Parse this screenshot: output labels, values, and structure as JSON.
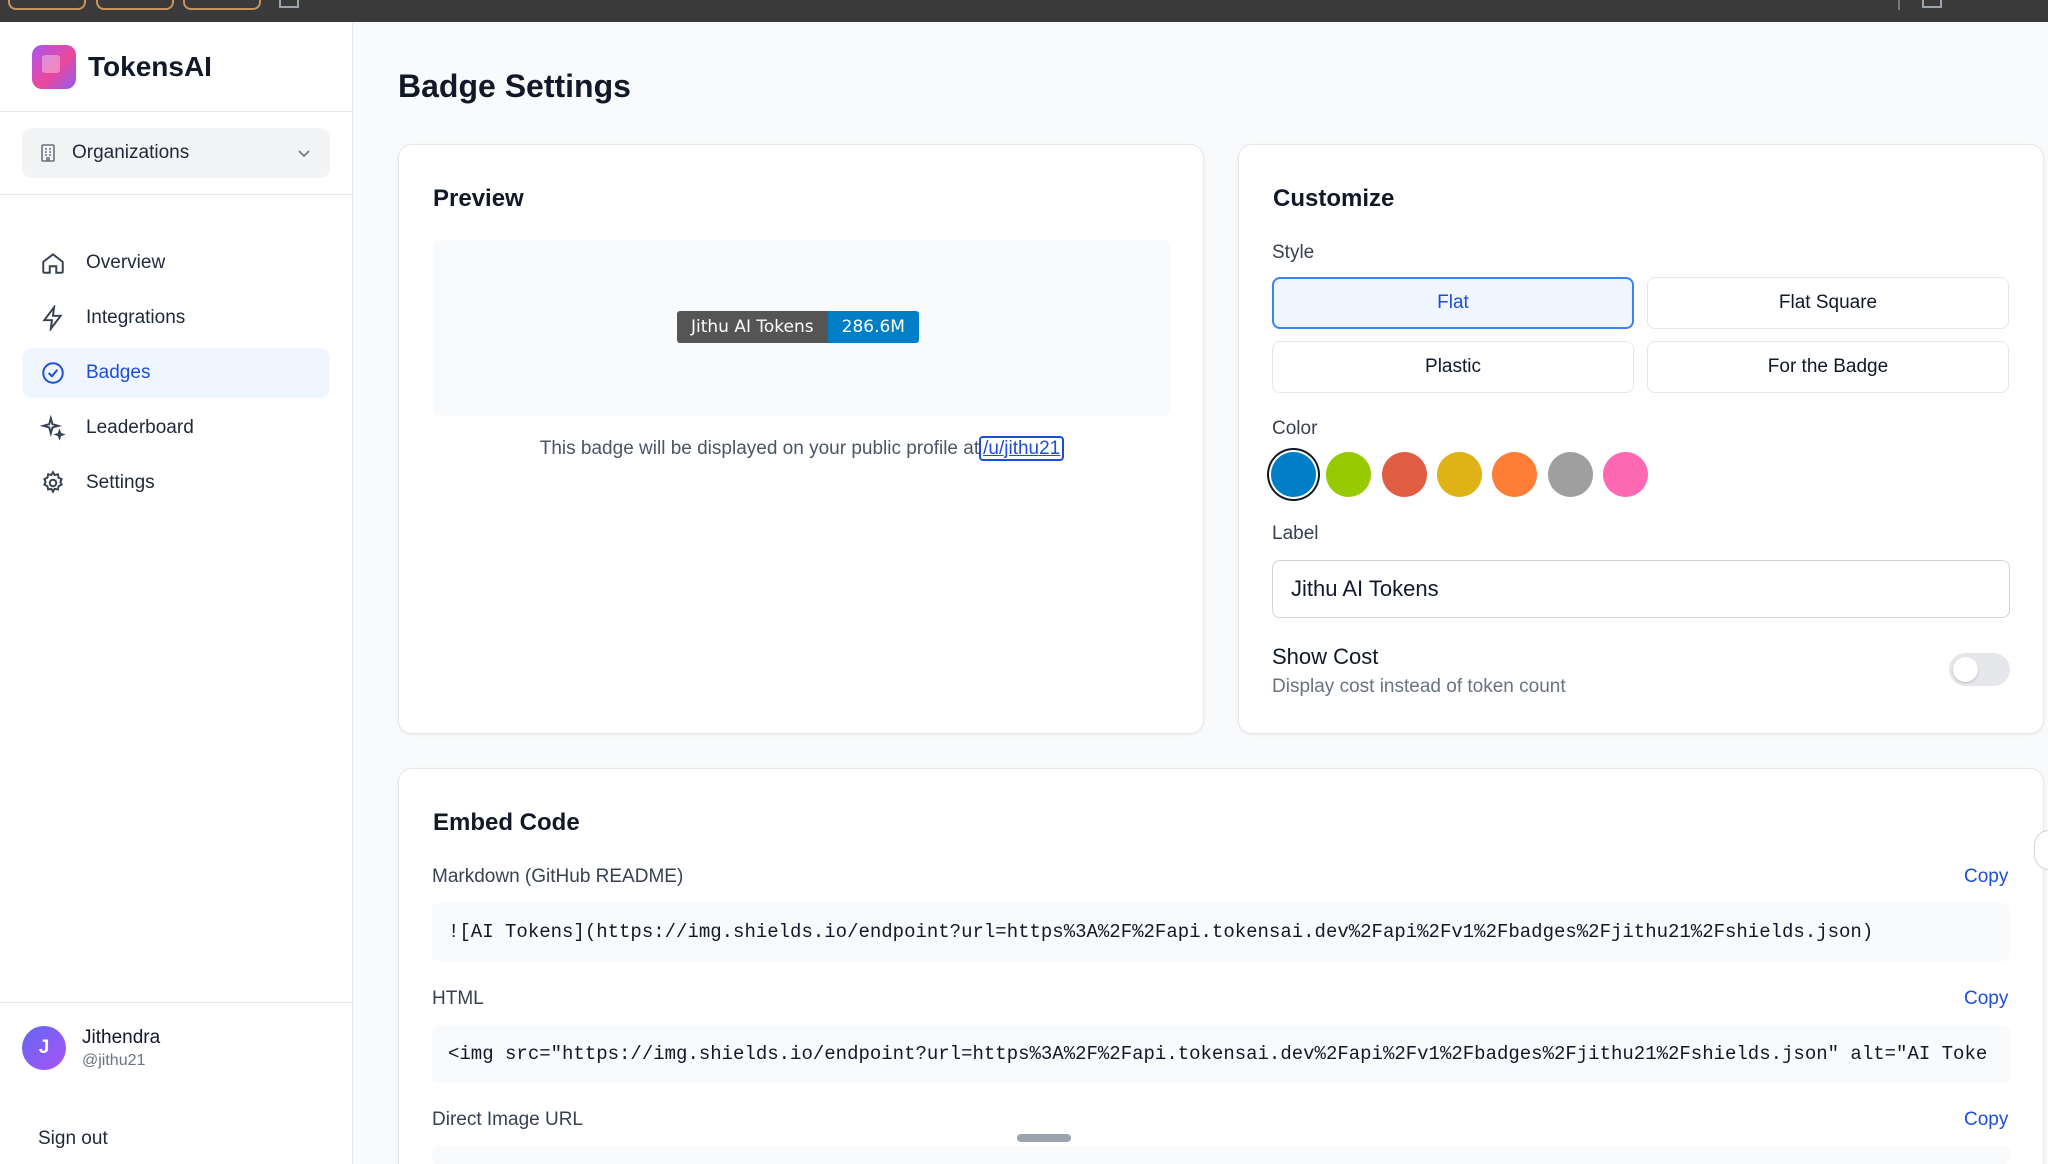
{
  "app": {
    "name": "TokensAI"
  },
  "org_selector": {
    "label": "Organizations"
  },
  "nav": [
    {
      "label": "Overview",
      "icon": "home-icon"
    },
    {
      "label": "Integrations",
      "icon": "bolt-icon"
    },
    {
      "label": "Badges",
      "icon": "check-circle-icon",
      "active": true
    },
    {
      "label": "Leaderboard",
      "icon": "sparkle-icon"
    },
    {
      "label": "Settings",
      "icon": "gear-icon"
    }
  ],
  "user": {
    "initial": "J",
    "name": "Jithendra",
    "handle": "@jithu21",
    "signout": "Sign out"
  },
  "page": {
    "title": "Badge Settings"
  },
  "preview": {
    "title": "Preview",
    "badge_label": "Jithu AI Tokens",
    "badge_value": "286.6M",
    "note": "This badge will be displayed on your public profile at",
    "profile_link": "/u/jithu21"
  },
  "customize": {
    "title": "Customize",
    "style_label": "Style",
    "styles": [
      "Flat",
      "Flat Square",
      "Plastic",
      "For the Badge"
    ],
    "selected_style": "Flat",
    "color_label": "Color",
    "colors": [
      "#007ec6",
      "#97ca00",
      "#e05d44",
      "#dfb317",
      "#fe7d37",
      "#9f9f9f",
      "#ff69b4"
    ],
    "selected_color": "#007ec6",
    "label_label": "Label",
    "label_value": "Jithu AI Tokens",
    "show_cost_title": "Show Cost",
    "show_cost_desc": "Display cost instead of token count",
    "show_cost_enabled": false
  },
  "embed": {
    "title": "Embed Code",
    "copy_label": "Copy",
    "markdown_label": "Markdown (GitHub README)",
    "markdown_code": "![AI Tokens](https://img.shields.io/endpoint?url=https%3A%2F%2Fapi.tokensai.dev%2Fapi%2Fv1%2Fbadges%2Fjithu21%2Fshields.json)",
    "html_label": "HTML",
    "html_code": "<img src=\"https://img.shields.io/endpoint?url=https%3A%2F%2Fapi.tokensai.dev%2Fapi%2Fv1%2Fbadges%2Fjithu21%2Fshields.json\" alt=\"AI Toke",
    "direct_label": "Direct Image URL"
  }
}
